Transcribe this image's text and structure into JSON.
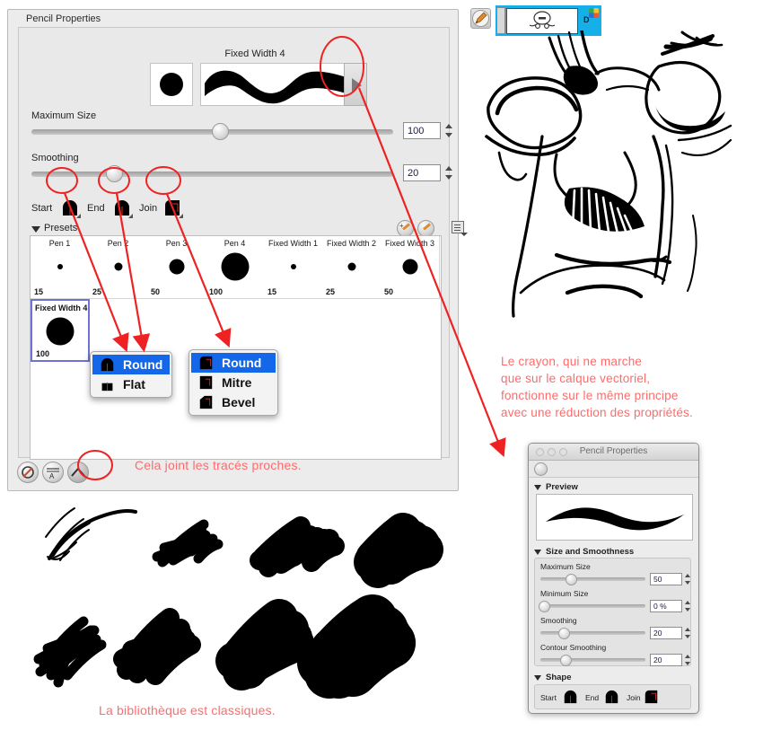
{
  "panel": {
    "title": "Pencil Properties",
    "preview": {
      "title": "Fixed Width 4"
    },
    "next_button_icon": "play-triangle-icon",
    "sliders": [
      {
        "label": "Maximum Size",
        "value": "100",
        "pct": 52
      },
      {
        "label": "Smoothing",
        "value": "20",
        "pct": 22
      }
    ],
    "shape": {
      "start_label": "Start",
      "end_label": "End",
      "join_label": "Join"
    },
    "presets_header": {
      "label": "Presets",
      "add_icon": "add-preset-icon",
      "edit_icon": "edit-preset-icon",
      "menu_icon": "preset-menu-icon"
    },
    "presets": [
      {
        "name": "Pen 1",
        "size": "15",
        "dot": 6
      },
      {
        "name": "Pen 2",
        "size": "25",
        "dot": 9
      },
      {
        "name": "Pen 3",
        "size": "50",
        "dot": 17
      },
      {
        "name": "Pen 4",
        "size": "100",
        "dot": 31
      },
      {
        "name": "Fixed Width 1",
        "size": "15",
        "dot": 6
      },
      {
        "name": "Fixed Width 2",
        "size": "25",
        "dot": 9
      },
      {
        "name": "Fixed Width 3",
        "size": "50",
        "dot": 17
      },
      {
        "name": "Fixed Width 4",
        "size": "100",
        "dot": 31,
        "selected": true
      }
    ],
    "bottom_tools": [
      {
        "icon": "no-color-icon"
      },
      {
        "icon": "text-baseline-icon"
      },
      {
        "icon": "join-strokes-icon",
        "active": true
      }
    ]
  },
  "popups": {
    "cap_menu": {
      "items": [
        {
          "label": "Round",
          "icon": "round-cap-icon",
          "selected": true
        },
        {
          "label": "Flat",
          "icon": "flat-cap-icon"
        }
      ]
    },
    "join_menu": {
      "items": [
        {
          "label": "Round",
          "icon": "round-join-icon",
          "selected": true
        },
        {
          "label": "Mitre",
          "icon": "mitre-join-icon"
        },
        {
          "label": "Bevel",
          "icon": "bevel-join-icon"
        }
      ]
    }
  },
  "annotations": {
    "join_note": "Cela joint les tracés proches.",
    "library_note": "La bibliothèque est classiques.",
    "pencil_note_lines": [
      "Le crayon, qui ne marche",
      "que sur le calque vectoriel,",
      "fonctionne sur le même principe",
      "avec une réduction des propriétés."
    ],
    "color": "#ff6b6b"
  },
  "toolbar": {
    "pencil_tool_icon": "pencil-tool-icon",
    "layer_label": "D"
  },
  "dialog": {
    "title": "Pencil Properties",
    "traffic_lights": [
      "close-button",
      "minimize-button",
      "zoom-button"
    ],
    "tool_icon": "brush-preset-icon",
    "sections": {
      "preview": "Preview",
      "size_and_smoothness": "Size and Smoothness",
      "shape": "Shape"
    },
    "sliders": [
      {
        "label": "Maximum Size",
        "value": "50",
        "pct": 28
      },
      {
        "label": "Minimum Size",
        "value": "0 %",
        "pct": 0
      },
      {
        "label": "Smoothing",
        "value": "20",
        "pct": 22
      },
      {
        "label": "Contour Smoothing",
        "value": "20",
        "pct": 24
      }
    ],
    "shape": {
      "start_label": "Start",
      "end_label": "End",
      "join_label": "Join"
    }
  }
}
